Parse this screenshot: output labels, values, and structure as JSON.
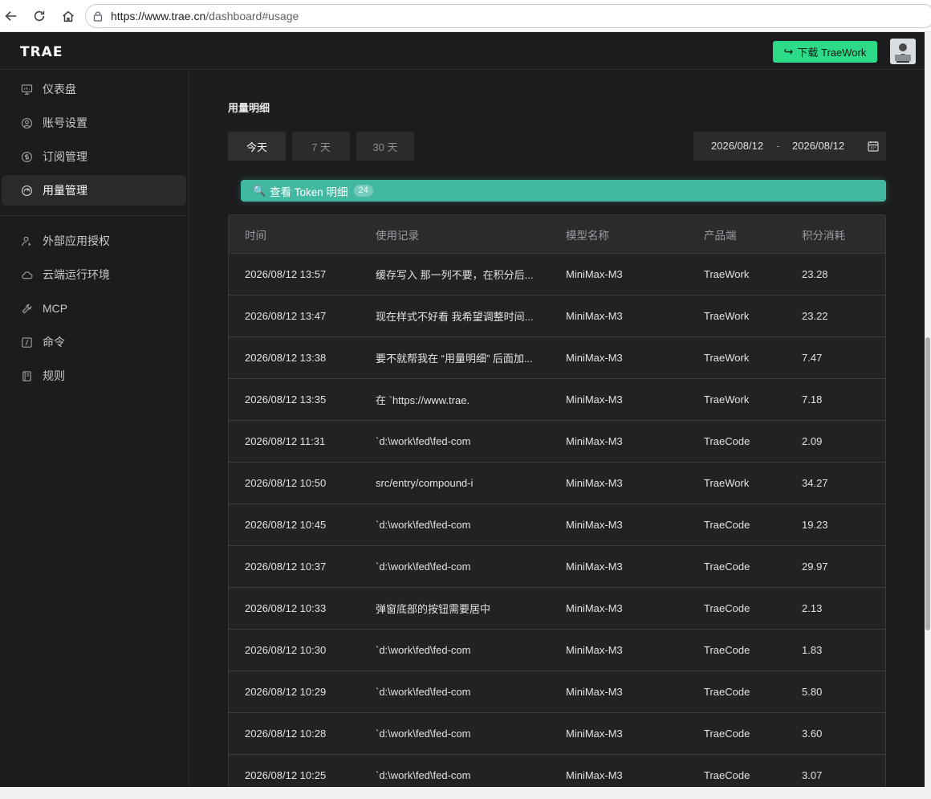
{
  "browser": {
    "url_host": "https://www.trae.cn",
    "url_path": "/dashboard#usage"
  },
  "header": {
    "logo": "TRAE",
    "download_label": "下载 TraeWork",
    "download_icon": "↪"
  },
  "sidebar": {
    "items": [
      {
        "label": "仪表盘",
        "icon": "monitor-icon"
      },
      {
        "label": "账号设置",
        "icon": "user-circle-icon"
      },
      {
        "label": "订阅管理",
        "icon": "dollar-circle-icon"
      },
      {
        "label": "用量管理",
        "icon": "gauge-icon"
      },
      {
        "label": "外部应用授权",
        "icon": "person-key-icon"
      },
      {
        "label": "云端运行环境",
        "icon": "cloud-icon"
      },
      {
        "label": "MCP",
        "icon": "wrench-icon"
      },
      {
        "label": "命令",
        "icon": "slash-command-icon"
      },
      {
        "label": "规则",
        "icon": "book-icon"
      }
    ],
    "active": "用量管理"
  },
  "main": {
    "section_title": "用量明细",
    "ranges": [
      "今天",
      "7 天",
      "30 天"
    ],
    "active_range": "今天",
    "date_start": "2026/08/12",
    "date_sep": "-",
    "date_end": "2026/08/12",
    "token_button": {
      "icon": "🔍",
      "label": "查看 Token 明细",
      "count": "24"
    },
    "table": {
      "headers": [
        "时间",
        "使用记录",
        "模型名称",
        "产品端",
        "积分消耗"
      ],
      "rows": [
        [
          "2026/08/12 13:57",
          "缓存写入 那一列不要，在积分后...",
          "MiniMax-M3",
          "TraeWork",
          "23.28"
        ],
        [
          "2026/08/12 13:47",
          "现在样式不好看 我希望调整时间...",
          "MiniMax-M3",
          "TraeWork",
          "23.22"
        ],
        [
          "2026/08/12 13:38",
          "要不就帮我在 “用量明细” 后面加...",
          "MiniMax-M3",
          "TraeWork",
          "7.47"
        ],
        [
          "2026/08/12 13:35",
          "在 `https://www.trae.",
          "MiniMax-M3",
          "TraeWork",
          "7.18"
        ],
        [
          "2026/08/12 11:31",
          "`d:\\work\\fed\\fed-com",
          "MiniMax-M3",
          "TraeCode",
          "2.09"
        ],
        [
          "2026/08/12 10:50",
          "src/entry/compound-i",
          "MiniMax-M3",
          "TraeWork",
          "34.27"
        ],
        [
          "2026/08/12 10:45",
          "`d:\\work\\fed\\fed-com",
          "MiniMax-M3",
          "TraeCode",
          "19.23"
        ],
        [
          "2026/08/12 10:37",
          "`d:\\work\\fed\\fed-com",
          "MiniMax-M3",
          "TraeCode",
          "29.97"
        ],
        [
          "2026/08/12 10:33",
          "弹窗底部的按钮需要居中",
          "MiniMax-M3",
          "TraeCode",
          "2.13"
        ],
        [
          "2026/08/12 10:30",
          "`d:\\work\\fed\\fed-com",
          "MiniMax-M3",
          "TraeCode",
          "1.83"
        ],
        [
          "2026/08/12 10:29",
          "`d:\\work\\fed\\fed-com",
          "MiniMax-M3",
          "TraeCode",
          "5.80"
        ],
        [
          "2026/08/12 10:28",
          "`d:\\work\\fed\\fed-com",
          "MiniMax-M3",
          "TraeCode",
          "3.60"
        ],
        [
          "2026/08/12 10:25",
          "`d:\\work\\fed\\fed-com",
          "MiniMax-M3",
          "TraeCode",
          "3.07"
        ]
      ]
    }
  },
  "colors": {
    "accent_green": "#2cda87",
    "token_teal": "#42b8a1",
    "background": "#1c1c1e"
  }
}
